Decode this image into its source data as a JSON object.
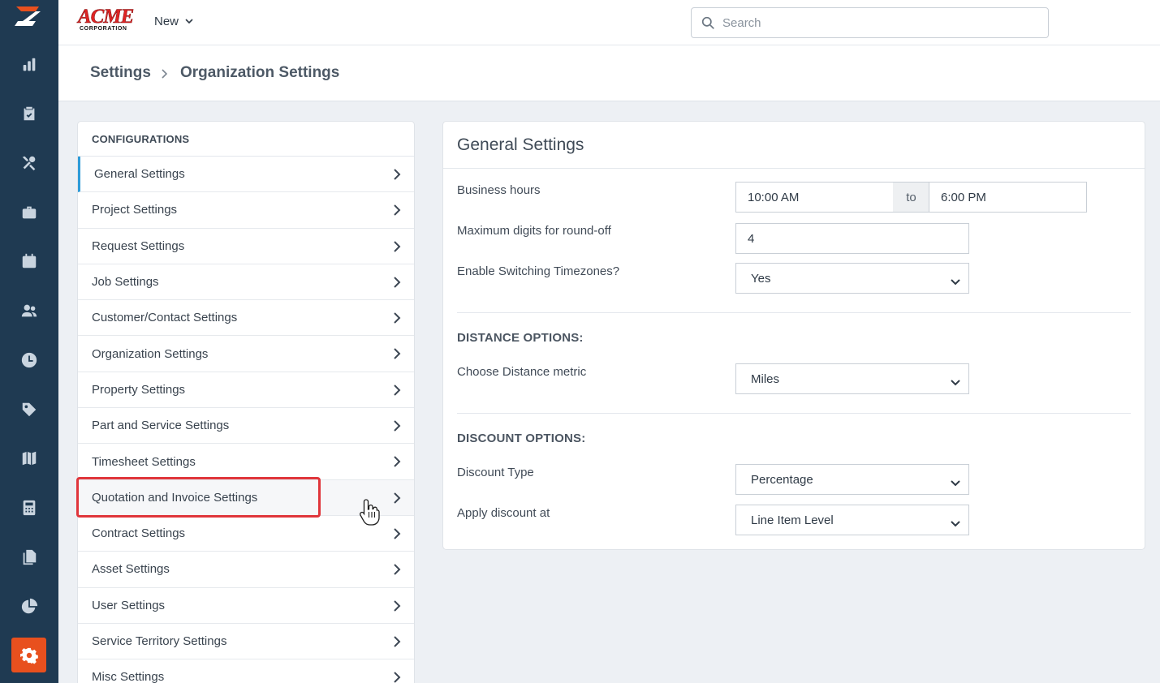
{
  "app": {
    "brand_main": "ACME",
    "brand_sub": "CORPORATION",
    "new_menu_label": "New"
  },
  "search": {
    "placeholder": "Search",
    "value": ""
  },
  "breadcrumb": {
    "root": "Settings",
    "current": "Organization Settings"
  },
  "sidebar_nav": [
    {
      "icon": "bar-chart-icon"
    },
    {
      "icon": "clipboard-check-icon"
    },
    {
      "icon": "tools-icon"
    },
    {
      "icon": "briefcase-icon"
    },
    {
      "icon": "calendar-icon"
    },
    {
      "icon": "users-icon"
    },
    {
      "icon": "clock-icon"
    },
    {
      "icon": "tag-icon"
    },
    {
      "icon": "map-icon"
    },
    {
      "icon": "calculator-icon"
    },
    {
      "icon": "documents-icon"
    },
    {
      "icon": "pie-chart-icon"
    },
    {
      "icon": "gear-icon",
      "active": true
    }
  ],
  "configurations": {
    "heading": "CONFIGURATIONS",
    "items": [
      {
        "label": "General Settings",
        "active": true
      },
      {
        "label": "Project Settings"
      },
      {
        "label": "Request Settings"
      },
      {
        "label": "Job Settings"
      },
      {
        "label": "Customer/Contact Settings"
      },
      {
        "label": "Organization Settings"
      },
      {
        "label": "Property Settings"
      },
      {
        "label": "Part and Service Settings"
      },
      {
        "label": "Timesheet Settings"
      },
      {
        "label": "Quotation and Invoice Settings",
        "highlighted": true
      },
      {
        "label": "Contract Settings"
      },
      {
        "label": "Asset Settings"
      },
      {
        "label": "User Settings"
      },
      {
        "label": "Service Territory Settings"
      },
      {
        "label": "Misc Settings"
      }
    ]
  },
  "general": {
    "title": "General Settings",
    "business_hours": {
      "label": "Business hours",
      "from": "10:00 AM",
      "separator": "to",
      "to": "6:00 PM"
    },
    "round_off": {
      "label": "Maximum digits for round-off",
      "value": "4"
    },
    "timezones": {
      "label": "Enable Switching Timezones?",
      "value": "Yes"
    },
    "distance": {
      "heading": "DISTANCE OPTIONS:",
      "label": "Choose Distance metric",
      "value": "Miles"
    },
    "discount": {
      "heading": "DISCOUNT OPTIONS:",
      "type_label": "Discount Type",
      "type_value": "Percentage",
      "apply_label": "Apply discount at",
      "apply_value": "Line Item Level"
    }
  },
  "colors": {
    "rail": "#1f3a52",
    "accent_orange": "#e8501e",
    "active_border": "#2d9bd8",
    "highlight_red": "#e0353b"
  }
}
